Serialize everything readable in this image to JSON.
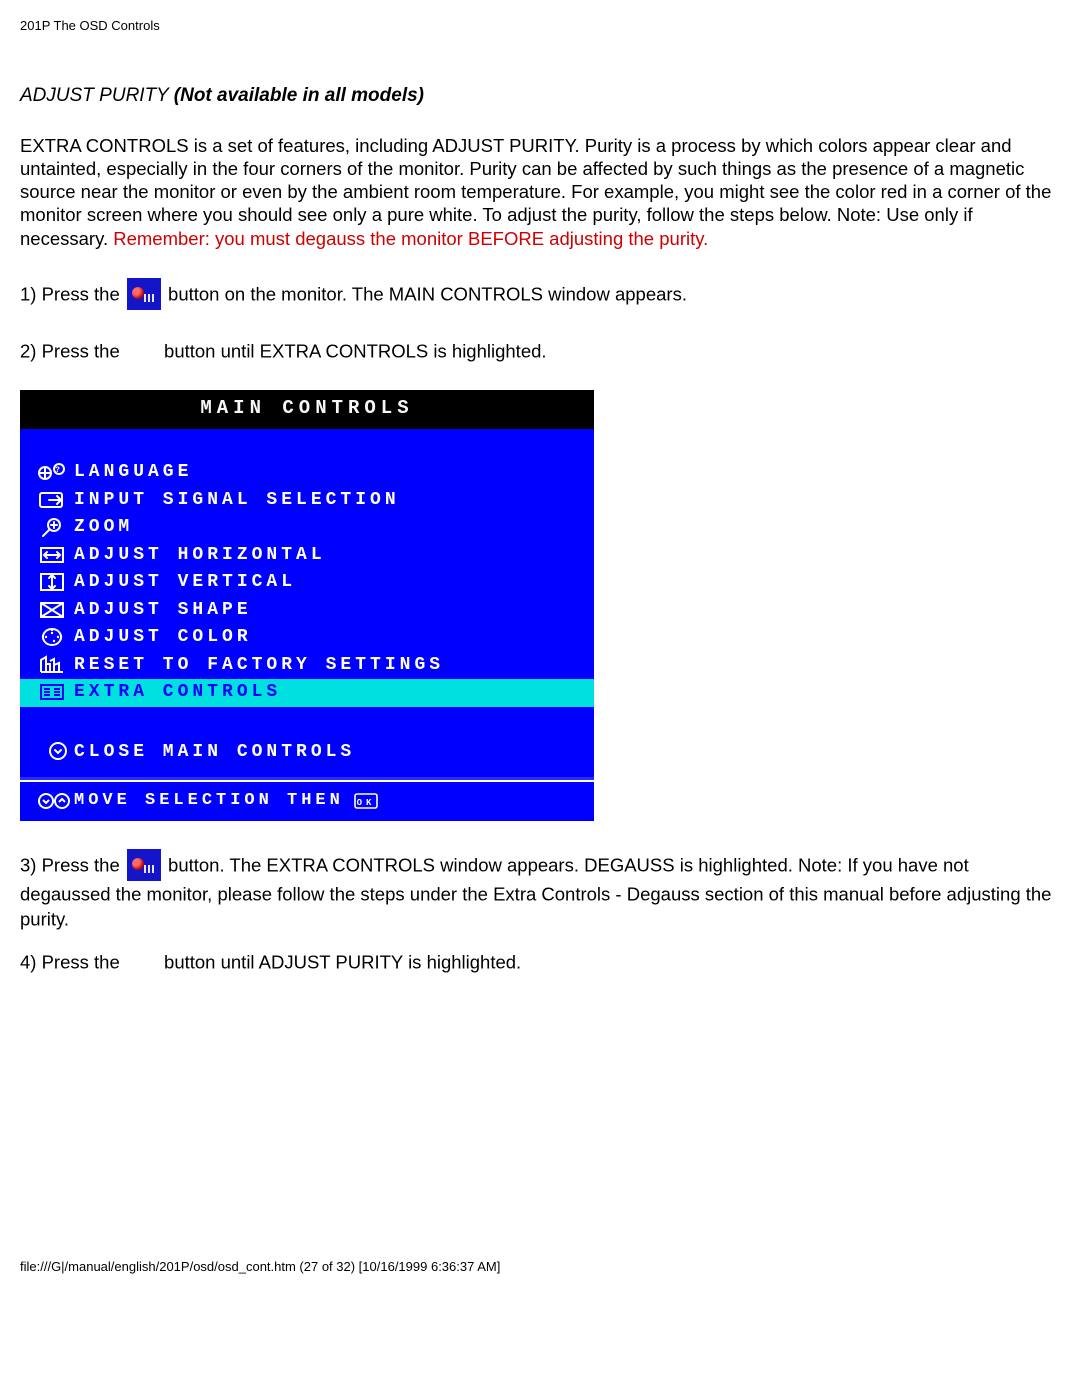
{
  "header": {
    "title": "201P The OSD Controls"
  },
  "section": {
    "title_lead": "ADJUST PURITY ",
    "title_note": "(Not available in all models)"
  },
  "intro": {
    "text": "EXTRA CONTROLS is a set of features, including ADJUST PURITY. Purity is a process by which colors appear clear and untainted, especially in the four corners of the monitor. Purity can be affected by such things as the presence of a magnetic source near the monitor or even by the ambient room temperature. For example, you might see the color red in a corner of the monitor screen where you should see only a pure white. To adjust the purity, follow the steps below. Note: Use only if necessary. ",
    "warn": "Remember: you must degauss the monitor BEFORE adjusting the purity."
  },
  "steps": {
    "s1a": "1) Press the ",
    "s1b": " button on the monitor. The MAIN CONTROLS window appears.",
    "s2a": "2) Press the ",
    "s2b": " button until EXTRA CONTROLS is highlighted.",
    "s3a": "3) Press the ",
    "s3b": " button. The EXTRA CONTROLS window appears. DEGAUSS is highlighted. Note: If you have not degaussed the monitor, please follow the steps under the Extra Controls - Degauss section of this manual before adjusting the purity.",
    "s4a": "4) Press the ",
    "s4b": " button until ADJUST PURITY is highlighted."
  },
  "osd": {
    "title": "MAIN CONTROLS",
    "items": [
      "LANGUAGE",
      "INPUT SIGNAL SELECTION",
      "ZOOM",
      "ADJUST HORIZONTAL",
      "ADJUST VERTICAL",
      "ADJUST SHAPE",
      "ADJUST COLOR",
      "RESET TO FACTORY SETTINGS",
      "EXTRA CONTROLS"
    ],
    "selected_index": 8,
    "close": "CLOSE MAIN CONTROLS",
    "footer": "MOVE SELECTION THEN",
    "footer_ok": "OK"
  },
  "footer": {
    "text": "file:///G|/manual/english/201P/osd/osd_cont.htm (27 of 32) [10/16/1999 6:36:37 AM]"
  }
}
